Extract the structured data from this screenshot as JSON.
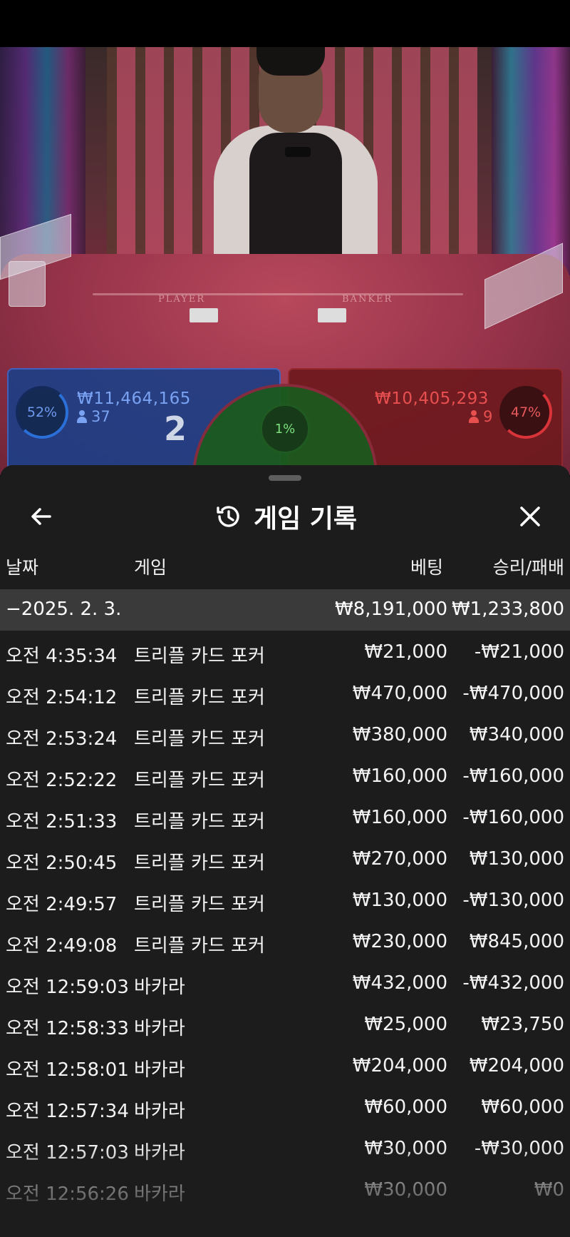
{
  "stream": {
    "table_left_label": "PLAYER",
    "table_right_label": "BANKER"
  },
  "bet_bar": {
    "player": {
      "percent": "52%",
      "amount": "₩11,464,165",
      "players": "37",
      "score": "2",
      "color": "#2b6fd8"
    },
    "tie": {
      "percent": "1%",
      "color": "#1d5a1f"
    },
    "banker": {
      "percent": "47%",
      "amount": "₩10,405,293",
      "players": "9",
      "color": "#d8343a"
    }
  },
  "sheet": {
    "back_icon": "arrow-left-icon",
    "history_icon": "history-clock-icon",
    "close_icon": "close-icon",
    "title": "게임 기록",
    "columns": {
      "date": "날짜",
      "game": "게임",
      "bet": "베팅",
      "result": "승리/패배"
    },
    "date_group": {
      "label": "−2025. 2. 3.",
      "bet_total": "₩8,191,000",
      "result_total": "₩1,233,800"
    },
    "rows": [
      {
        "time": "오전 4:35:34",
        "game": "트리플 카드 포커",
        "bet": "₩21,000",
        "result": "-₩21,000"
      },
      {
        "time": "오전 2:54:12",
        "game": "트리플 카드 포커",
        "bet": "₩470,000",
        "result": "-₩470,000"
      },
      {
        "time": "오전 2:53:24",
        "game": "트리플 카드 포커",
        "bet": "₩380,000",
        "result": "₩340,000"
      },
      {
        "time": "오전 2:52:22",
        "game": "트리플 카드 포커",
        "bet": "₩160,000",
        "result": "-₩160,000"
      },
      {
        "time": "오전 2:51:33",
        "game": "트리플 카드 포커",
        "bet": "₩160,000",
        "result": "-₩160,000"
      },
      {
        "time": "오전 2:50:45",
        "game": "트리플 카드 포커",
        "bet": "₩270,000",
        "result": "₩130,000"
      },
      {
        "time": "오전 2:49:57",
        "game": "트리플 카드 포커",
        "bet": "₩130,000",
        "result": "-₩130,000"
      },
      {
        "time": "오전 2:49:08",
        "game": "트리플 카드 포커",
        "bet": "₩230,000",
        "result": "₩845,000"
      },
      {
        "time": "오전 12:59:03",
        "game": "바카라",
        "bet": "₩432,000",
        "result": "-₩432,000"
      },
      {
        "time": "오전 12:58:33",
        "game": "바카라",
        "bet": "₩25,000",
        "result": "₩23,750"
      },
      {
        "time": "오전 12:58:01",
        "game": "바카라",
        "bet": "₩204,000",
        "result": "₩204,000"
      },
      {
        "time": "오전 12:57:34",
        "game": "바카라",
        "bet": "₩60,000",
        "result": "₩60,000"
      },
      {
        "time": "오전 12:57:03",
        "game": "바카라",
        "bet": "₩30,000",
        "result": "-₩30,000"
      },
      {
        "time": "오전 12:56:26",
        "game": "바카라",
        "bet": "₩30,000",
        "result": "₩0"
      }
    ]
  }
}
